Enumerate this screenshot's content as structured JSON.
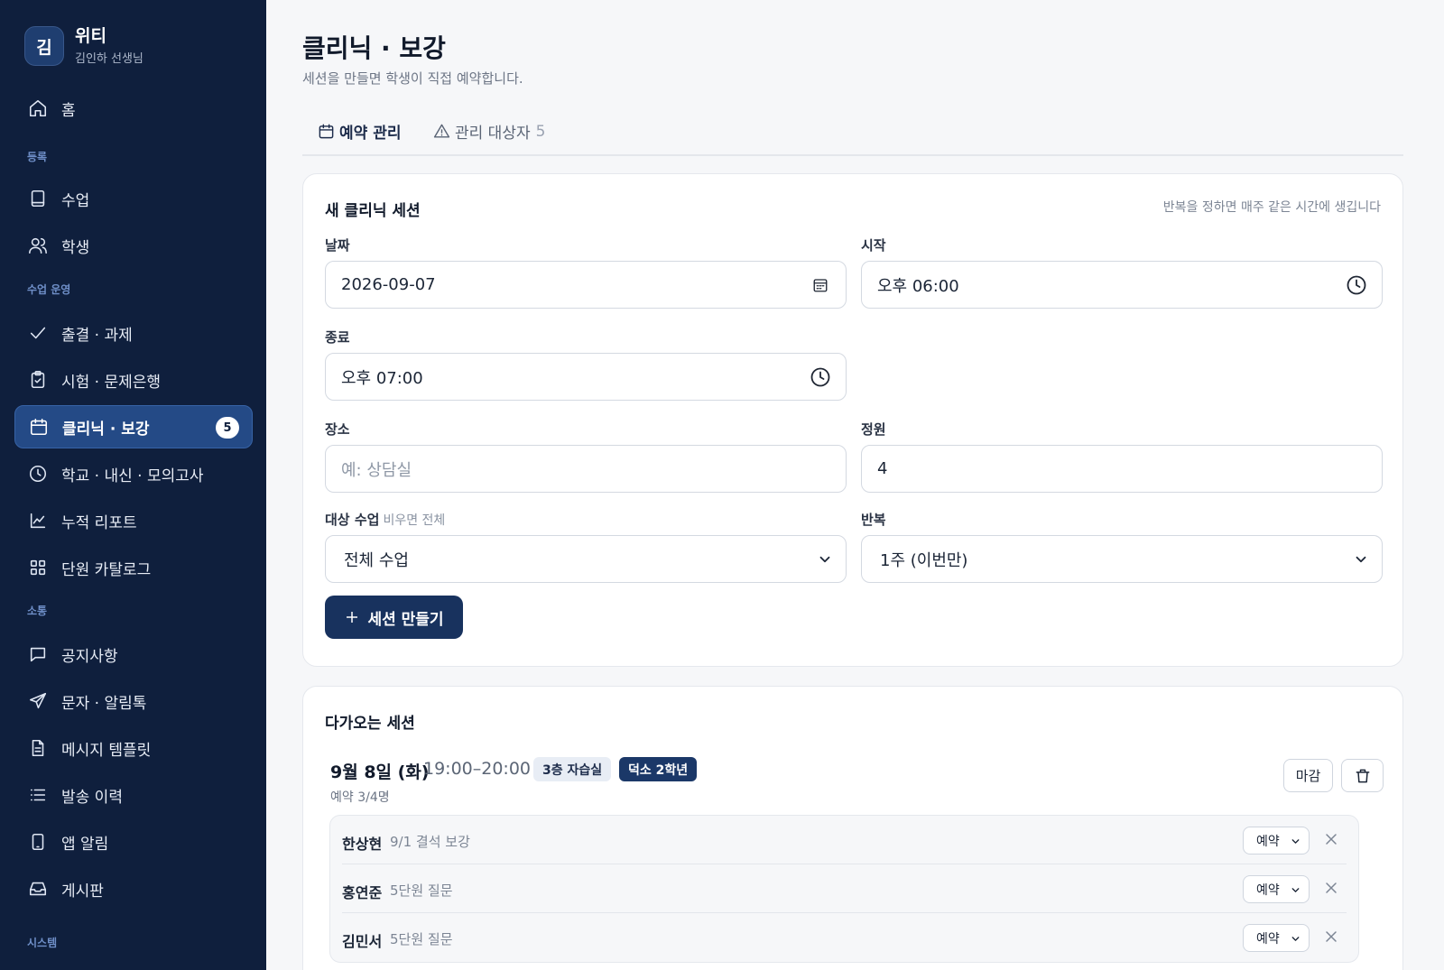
{
  "brand": {
    "avatar_letter": "김",
    "name": "위티",
    "subtitle": "김인하 선생님"
  },
  "sidebar": {
    "home": {
      "label": "홈",
      "icon": "home-icon"
    },
    "sections": {
      "register": "등록",
      "class_ops": "수업 운영",
      "communication": "소통",
      "system": "시스템"
    },
    "items": [
      {
        "label": "수업",
        "icon": "book-icon"
      },
      {
        "label": "학생",
        "icon": "users-icon"
      },
      {
        "label": "출결 · 과제",
        "icon": "check-icon"
      },
      {
        "label": "시험 · 문제은행",
        "icon": "clipboard-icon"
      },
      {
        "label": "클리닉 · 보강",
        "icon": "calendar-icon",
        "active": true,
        "badge": "5"
      },
      {
        "label": "학교 · 내신 · 모의고사",
        "icon": "clock-icon"
      },
      {
        "label": "누적 리포트",
        "icon": "chart-line-icon"
      },
      {
        "label": "단원 카탈로그",
        "icon": "grid-icon"
      },
      {
        "label": "공지사항",
        "icon": "message-square-icon"
      },
      {
        "label": "문자 · 알림톡",
        "icon": "send-icon"
      },
      {
        "label": "메시지 템플릿",
        "icon": "file-text-icon"
      },
      {
        "label": "발송 이력",
        "icon": "list-icon"
      },
      {
        "label": "앱 알림",
        "icon": "smartphone-icon"
      },
      {
        "label": "게시판",
        "icon": "inbox-icon"
      }
    ]
  },
  "page": {
    "title": "클리닉 · 보강",
    "subtitle": "세션을 만들면 학생이 직접 예약합니다."
  },
  "tabs": [
    {
      "label": "예약 관리",
      "icon": "calendar-icon",
      "active": true
    },
    {
      "label": "관리 대상자",
      "icon": "alert-triangle-icon",
      "count": "5"
    }
  ],
  "new_session": {
    "title": "새 클리닉 세션",
    "hint": "반복을 정하면 매주 같은 시간에 생깁니다",
    "date": {
      "label": "날짜",
      "value": "2026-09-07"
    },
    "start": {
      "label": "시작",
      "value": "오후 06:00"
    },
    "end": {
      "label": "종료",
      "value": "오후 07:00"
    },
    "place": {
      "label": "장소",
      "placeholder": "예: 상담실"
    },
    "capacity": {
      "label": "정원",
      "value": "4"
    },
    "target_class": {
      "label": "대상 수업",
      "hint": "비우면 전체",
      "value": "전체 수업"
    },
    "repeat": {
      "label": "반복",
      "value": "1주 (이번만)"
    },
    "create_label": "세션 만들기"
  },
  "upcoming": {
    "title": "다가오는 세션",
    "sessions": [
      {
        "date": "9월 8일 (화)",
        "time": "19:00–20:00",
        "room_tag": "3층 자습실",
        "class_tag": "덕소 2학년",
        "booking": "예약 3/4명",
        "close_label": "마감",
        "bookings": [
          {
            "name": "한상현",
            "note": "9/1 결석 보강",
            "status": "예약"
          },
          {
            "name": "홍연준",
            "note": "5단원 질문",
            "status": "예약"
          },
          {
            "name": "김민서",
            "note": "5단원 질문",
            "status": "예약"
          }
        ]
      }
    ]
  },
  "colors": {
    "sidebar_bg": "#0f1f3d",
    "active_nav": "#244a86",
    "primary_button": "#18325e",
    "class_tag": "#1b3868"
  }
}
